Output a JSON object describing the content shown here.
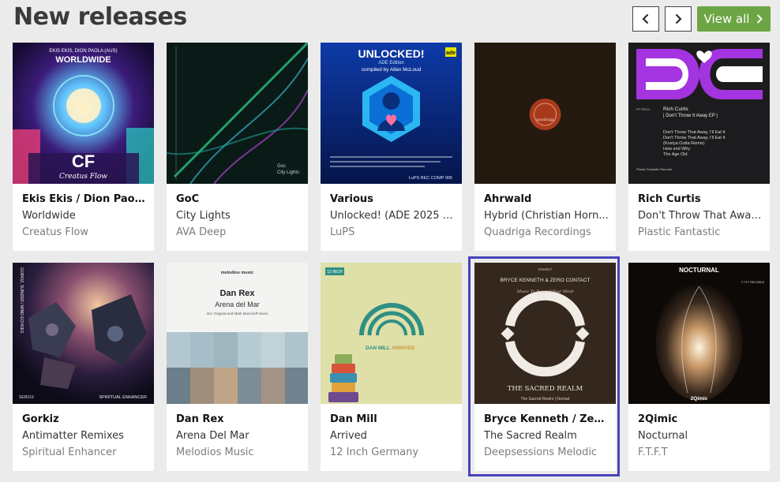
{
  "header": {
    "title": "New releases",
    "view_all_label": "View all",
    "prev_icon": "chevron-left-icon",
    "next_icon": "chevron-right-icon",
    "accent": "#6da544"
  },
  "selection_color": "#4742b8",
  "releases": [
    {
      "artist": "Ekis Ekis / Dion Paola ...",
      "title": "Worldwide",
      "label": "Creatus Flow",
      "art": {
        "top_text": "EKIS EKIS, DION PAOLA (AUS)",
        "headline": "WORLDWIDE",
        "logo": "CF",
        "script": "Creatus Flow"
      }
    },
    {
      "artist": "GoC",
      "title": "City Lights",
      "label": "AVA Deep",
      "art": {
        "line1": "Goc",
        "line2": "City Lights"
      }
    },
    {
      "artist": "Various",
      "title": "Unlocked! (ADE 2025 E...",
      "label": "LuPS",
      "art": {
        "headline": "UNLOCKED!",
        "badge": "ade",
        "sub": "ADE Edition",
        "compiled": "compiled by Allan McLoud",
        "footer": "LuPS REC COMP 005"
      }
    },
    {
      "artist": "Ahrwald",
      "title": "Hybrid (Christian Horn...",
      "label": "Quadriga Recordings",
      "art": {
        "logo": "quadriga"
      }
    },
    {
      "artist": "Rich Curtis",
      "title": "Don't Throw That Away,...",
      "label": "Plastic Fantastic",
      "art": {
        "cat": "PFTR014",
        "head": "Rich Curtis",
        "head2": "| Don't Throw It Away EP |",
        "tracks": [
          "Don't Throw That Away, I'll Eat It",
          "Don't Throw That Away, I'll Eat It",
          "(Kostya Outta Remix)",
          "How and Why",
          "The Age Old"
        ],
        "brand": "Plastic Fantastic Records"
      }
    },
    {
      "artist": "Gorkiz",
      "title": "Antimatter Remixes",
      "label": "Spiritual Enhancer",
      "art": {
        "side": "GORKIZ, SUNIZER / MIND ECHOES",
        "cat": "SER019",
        "brand": "SPIRITUAL ENHANCER"
      }
    },
    {
      "artist": "Dan Rex",
      "title": "Arena Del Mar",
      "label": "Melodios Music",
      "art": {
        "logo": "melodios music",
        "head": "Dan Rex",
        "sub": "Arena del Mar",
        "note": "incl. Original and Mark Moncrieff mixes"
      }
    },
    {
      "artist": "Dan Mill",
      "title": "Arrived",
      "label": "12 Inch Germany",
      "art": {
        "brand": "12 INCH",
        "name": "DAN MILL",
        "word": "ARRIVED"
      }
    },
    {
      "artist": "Bryce Kenneth / Zero ...",
      "title": "The Sacred Realm",
      "label": "Deepsessions Melodic",
      "art": {
        "cat": "DSM047",
        "head": "BRYCE KENNETH & ZERO CONTACT",
        "script": "Music To Expand Your Mind",
        "realm": "THE SACRED REALM",
        "sub": "The Sacred Realm | Nomad"
      }
    },
    {
      "artist": "2Qimic",
      "title": "Nocturnal",
      "label": "F.T.F.T",
      "art": {
        "head": "NOCTURNAL",
        "name": "2Qimic",
        "brand": "F.T.F.T RECORDS"
      }
    }
  ]
}
